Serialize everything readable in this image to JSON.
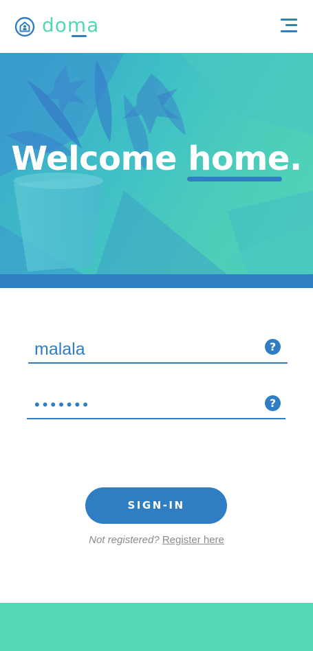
{
  "brand": {
    "name": "doma",
    "logo_icon": "house-circle-icon",
    "colors": {
      "primary": "#2f7dc3",
      "accent": "#55d8b5"
    }
  },
  "header": {
    "menu_icon": "hamburger-menu-icon"
  },
  "hero": {
    "title_prefix": "Welcome ",
    "title_highlight": "home.",
    "background": "flowers-photo-teal-overlay"
  },
  "login": {
    "username_value": "malala",
    "password_mask": "•••••••",
    "help_glyph": "?",
    "signin_label": "SIGN-IN",
    "not_registered": "Not registered?",
    "register_link": "Register here"
  }
}
